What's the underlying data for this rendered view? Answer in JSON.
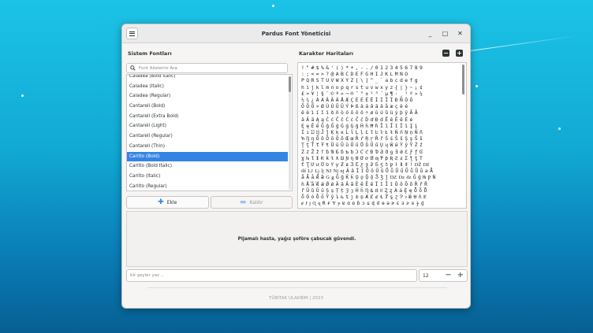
{
  "window": {
    "title": "Pardus Font Yöneticisi",
    "controls": {
      "minimize": "_",
      "maximize": "□",
      "close": "✕"
    }
  },
  "left_panel": {
    "title": "Sistem Fontları",
    "search_placeholder": "Font Ailelerini Ara",
    "fonts": [
      "Caladea (Bold Italic)",
      "Caladea (Italic)",
      "Caladea (Regular)",
      "Cantarell (Bold)",
      "Cantarell (Extra Bold)",
      "Cantarell (Light)",
      "Cantarell (Regular)",
      "Cantarell (Thin)",
      "Carlito (Bold)",
      "Carlito (Bold Italic)",
      "Carlito (Italic)",
      "Carlito (Regular)"
    ],
    "selected_font": "Carlito (Bold)",
    "add_button": "Ekle",
    "remove_button": "Kaldır"
  },
  "right_panel": {
    "title": "Karakter Haritaları",
    "zoom_out": "−",
    "zoom_in": "+",
    "charmap_rows": [
      "!\"#$%&'()*+,-./0123456789",
      ":;<=>?@ABCDEFGHIJKLMNO",
      "PQRSTUVWXYZ[\\]^_`abcdefg",
      "hijklmnopqrstuvwxyz{|}~¡¢",
      "£¤¥¦§¨©ª«¬®¯°±²³´µ¶·¸¹º»¼",
      "½¾¿ÀÁÂÃÄÅÆÇÈÉÊËÌÍÎÏÐÑÒÓ",
      "ÔÕÖ×ØÙÚÛÜÝÞßàáâãäåæçèé",
      "êëìíîïðñòóôõö÷øùúûüýþÿĀĀ",
      "āĂăĄąĆćĈĉĊċČčĎďĐđĒēĔĕĖė",
      "ĘęĚěĜĝĞğĠġĢģĤĥĦħĨĩĪīĬĭĮį",
      "İıĲĳĴĵĶķĸĹĺĻļĽľĿŀŁłŃńŅņŇň",
      "ŉŊŋŌōŎŏŐőŒœŔŕŖŗŘřŚśŜŝŞşŠš",
      "ŢţŤťŦŧŨũŪūŬŭŮůŰűŲųŴŵŶŷŸŹź",
      "ŻżŽžſƀƁƂƃƄƅƆƇƈƉƊƋƌƍƎƏƐƑƒƓ",
      "ƔƕƖƗƘƙƚƛƜƝƞƟƠơƢƣƤƥƦƧƨƩƪƫƬ",
      "ƭƮƯưƱƲƳƴƵƶƷƸƹƺƻƼƽƾƿǀǁǂǃǄǅ",
      "ǆǇǈǉǊǋǌǍǎǏǐǑǒǓǔǕǖǗǘǙǚǛǜǝǞ",
      "ǟǠǡǢǣǤǥǦǧǨǩǪǫǬǭǮǯǰǱǲǳǴǵǶǷǸ",
      "ǹǺǻǼǽǾǿȀȁȂȃȄȅȆȇȈȉȊȋȌȍȎȏȐȑȒ",
      "ȓȔȕȖȗȘșȚțȜȝȞȟȠȡȢȣȤȥȦȧȨȩȪȫȬ",
      "ȭȮȯȰȱȲȳȴȵȶȷȸȹȺȻȼȽȾȿɀɁɂɃɄɅɆ",
      "ɇɈɉɊɋɌɍɎɏɐɑɒɓɔɕɖɗɘəɚɛɜɝɞɟɠ"
    ]
  },
  "preview": {
    "text": "Pijamalı hasta, yağız şoföre çabucak güvendi."
  },
  "input_row": {
    "placeholder": "bir şeyler yaz ..",
    "size": "12",
    "decrement": "−",
    "increment": "+"
  },
  "footer": {
    "text": "TÜBİTAK ULAKBİM | 2023"
  },
  "colors": {
    "accent": "#3584e4",
    "desktop_top": "#1cc3e6",
    "desktop_bottom": "#075f93"
  }
}
